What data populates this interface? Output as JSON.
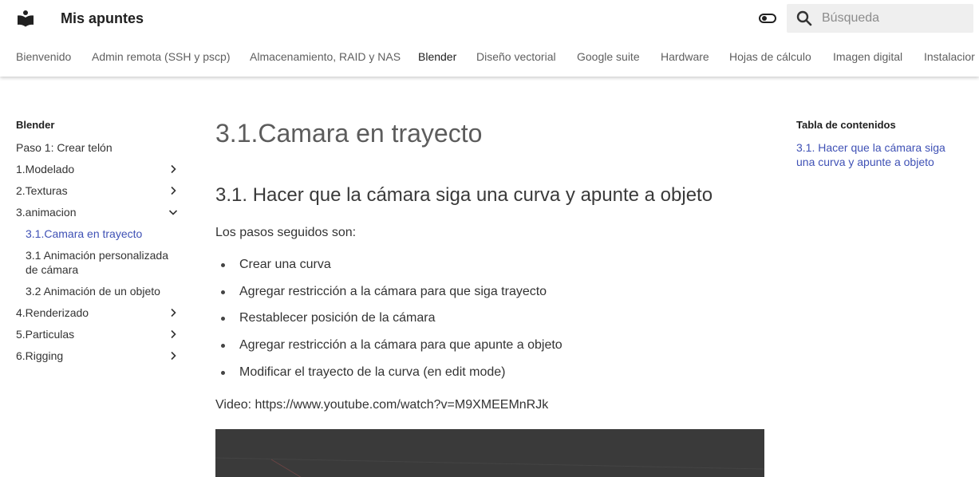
{
  "header": {
    "site_title": "Mis apuntes",
    "search_placeholder": "Búsqueda",
    "accent_color": "#3f51b5",
    "logo_icon": "book-reader-icon",
    "theme_icon": "toggle-icon",
    "search_icon": "search-icon"
  },
  "tabs": [
    {
      "label": "Bienvenido"
    },
    {
      "label": "Admin remota (SSH y pscp)"
    },
    {
      "label": "Almacenamiento, RAID y NAS"
    },
    {
      "label": "Blender",
      "active": true
    },
    {
      "label": "Diseño vectorial"
    },
    {
      "label": "Google suite"
    },
    {
      "label": "Hardware"
    },
    {
      "label": "Hojas de cálculo"
    },
    {
      "label": "Imagen digital"
    },
    {
      "label": "Instalacior"
    }
  ],
  "sidebar": {
    "title": "Blender",
    "items": [
      {
        "label": "Paso 1: Crear telón"
      },
      {
        "label": "1.Modelado",
        "chevron": "chevron-right-icon"
      },
      {
        "label": "2.Texturas",
        "chevron": "chevron-right-icon"
      },
      {
        "label": "3.animacion",
        "chevron": "chevron-down-icon"
      },
      {
        "label": "3.1.Camara en trayecto",
        "current": true
      },
      {
        "label": "3.1 Animación personalizada de cámara"
      },
      {
        "label": "3.2 Animación de un objeto"
      },
      {
        "label": "4.Renderizado",
        "chevron": "chevron-right-icon"
      },
      {
        "label": "5.Particulas",
        "chevron": "chevron-right-icon"
      },
      {
        "label": "6.Rigging",
        "chevron": "chevron-right-icon"
      }
    ]
  },
  "main": {
    "title": "3.1.Camara en trayecto",
    "subtitle": "3.1. Hacer que la cámara siga una curva y apunte a objeto",
    "intro": "Los pasos seguidos son:",
    "steps": [
      "Crear una curva",
      "Agregar restricción a la cámara para que siga trayecto",
      "Restablecer posición de la cámara",
      "Agregar restricción a la cámara para que apunte a objeto",
      "Modificar el trayecto de la curva (en edit mode)"
    ],
    "video_text": "Video: https://www.youtube.com/watch?v=M9XMEEMnRJk"
  },
  "toc": {
    "title": "Tabla de contenidos",
    "link": "3.1. Hacer que la cámara siga una curva y apunte a objeto"
  }
}
